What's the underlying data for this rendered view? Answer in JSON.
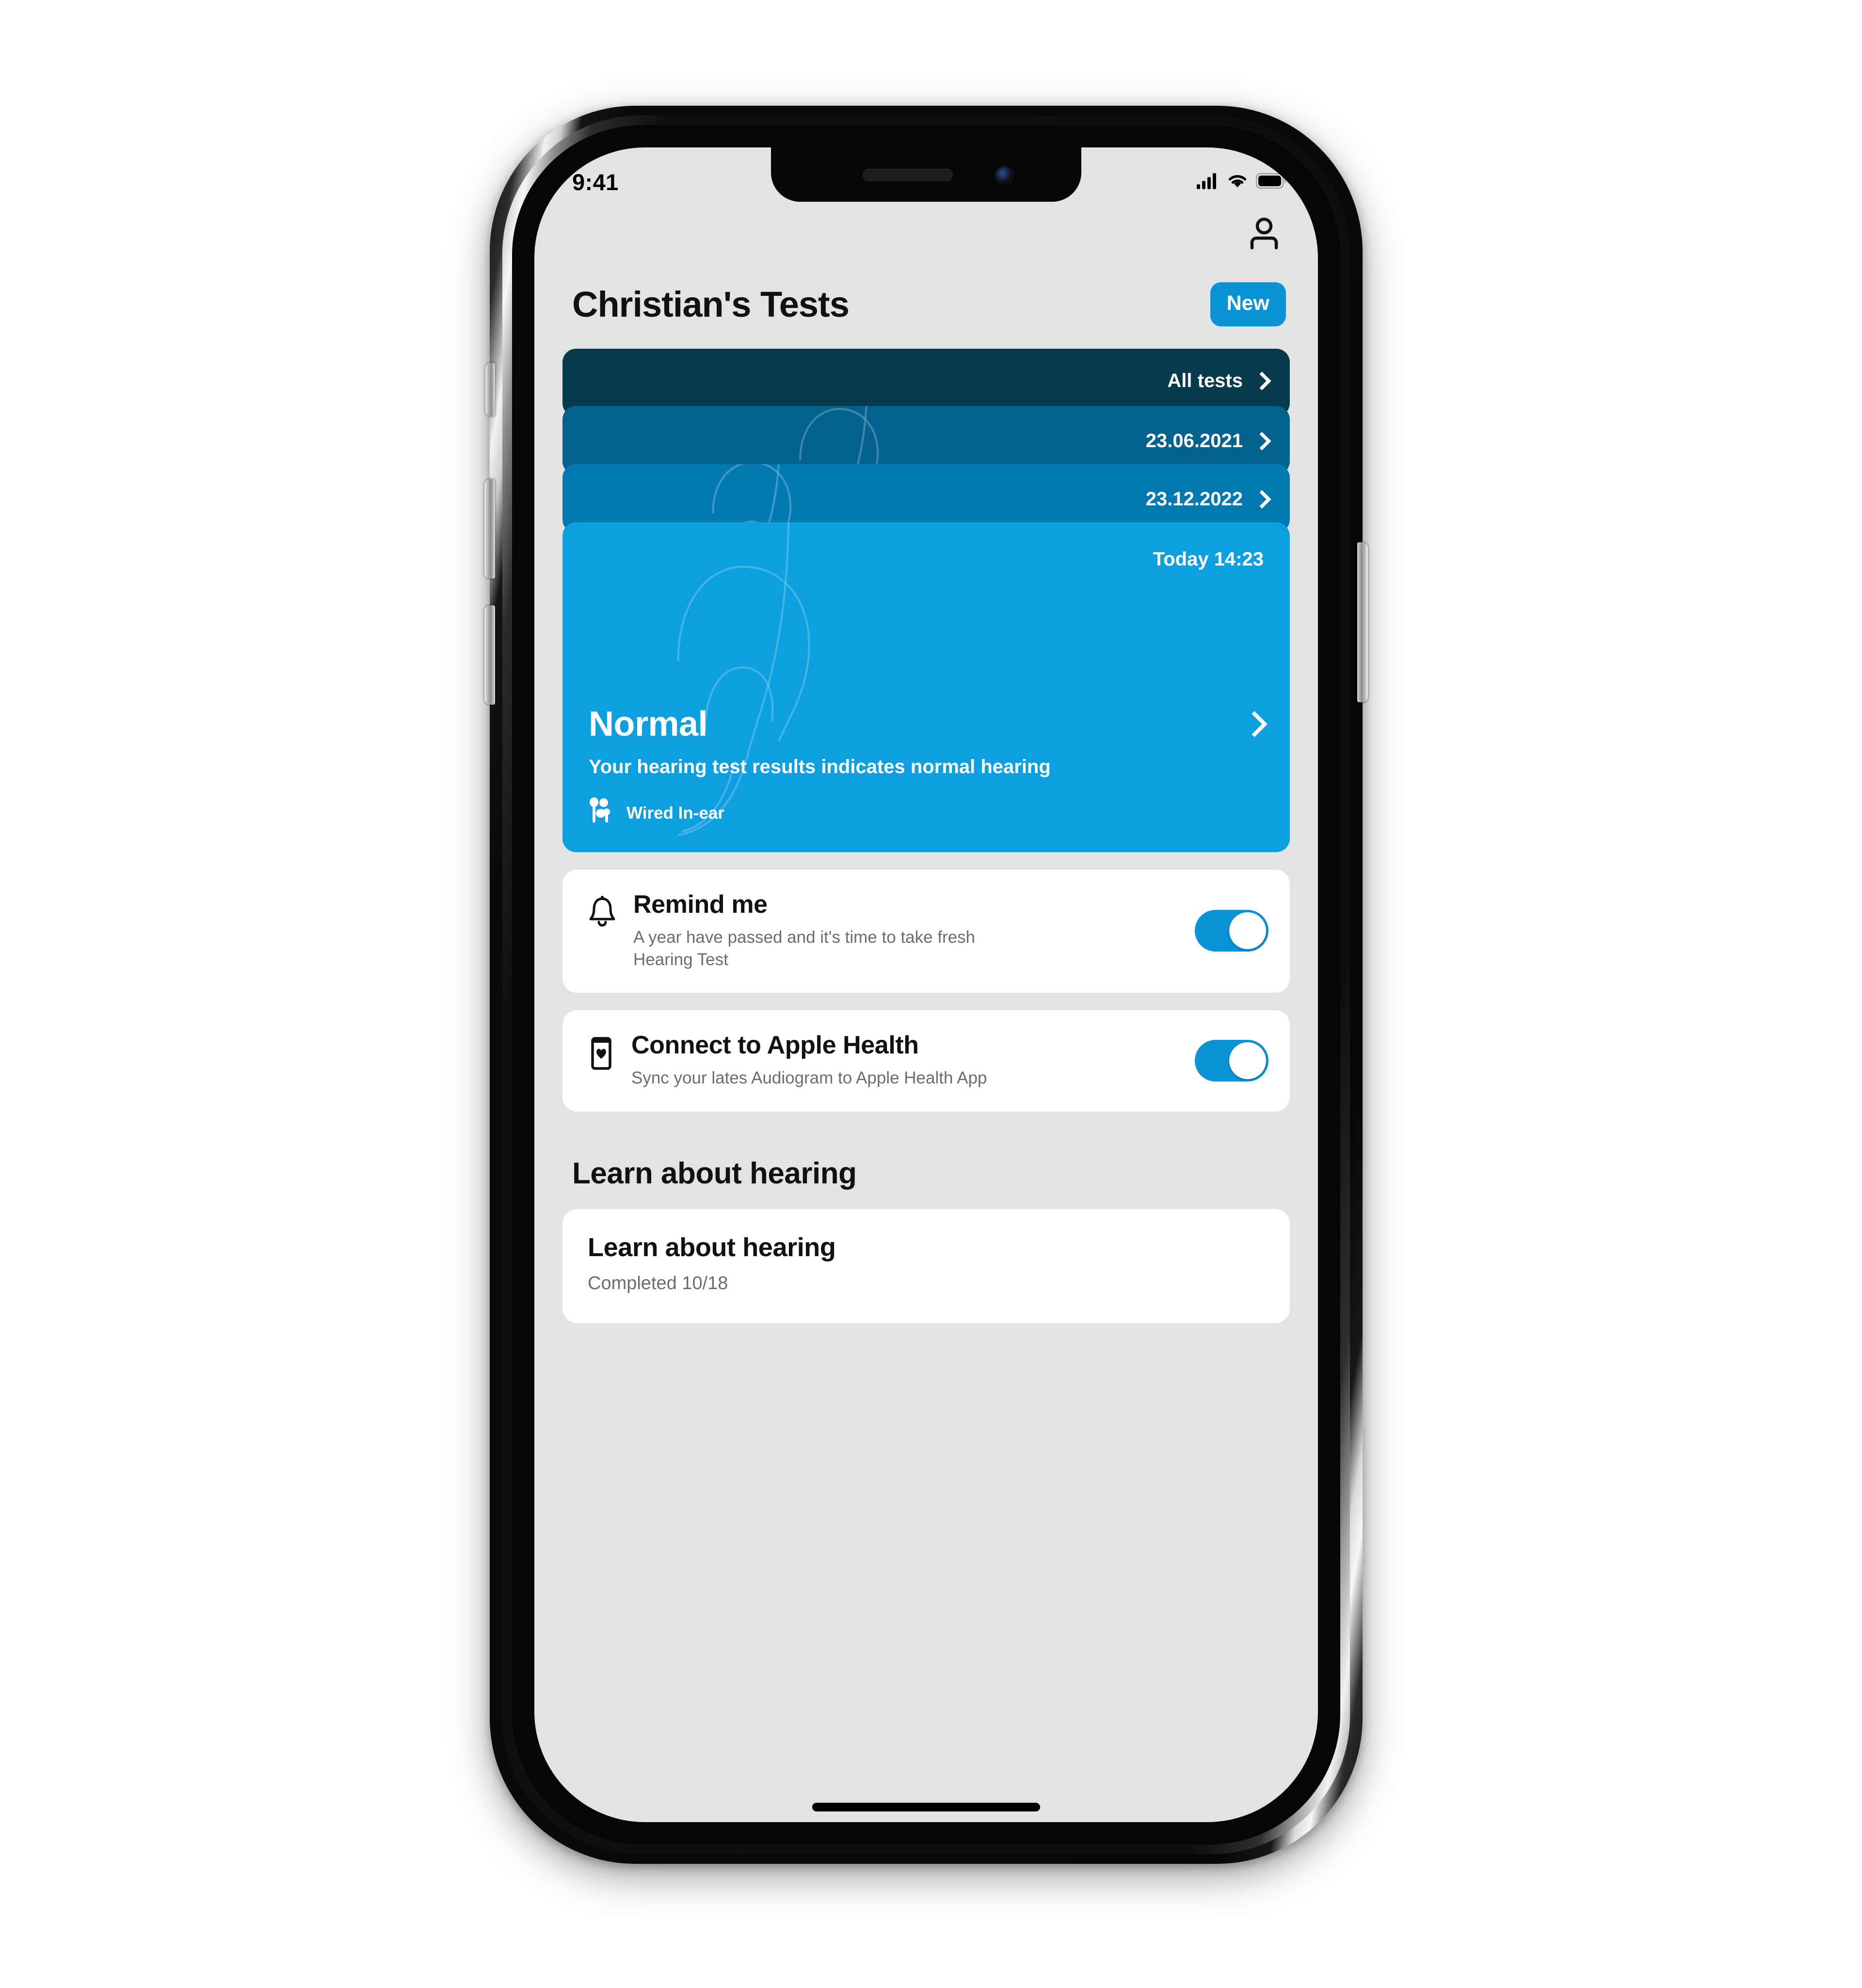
{
  "status_bar": {
    "time": "9:41",
    "signal_icon": "cellular-signal-icon",
    "wifi_icon": "wifi-icon",
    "battery_icon": "battery-full-icon"
  },
  "topbar": {
    "account_icon": "person-icon"
  },
  "header": {
    "title": "Christian's Tests",
    "new_button_label": "New"
  },
  "test_stack": {
    "all_tests_label": "All tests",
    "items": [
      {
        "label": "23.06.2021",
        "color": "#04628e"
      },
      {
        "label": "23.12.2022",
        "color": "#0379b1"
      }
    ],
    "latest": {
      "timestamp": "Today 14:23",
      "result_title": "Normal",
      "result_description": "Your hearing test results indicates normal hearing",
      "device_label": "Wired In-ear",
      "device_icon": "earbuds-icon",
      "color": "#0d9fdf"
    },
    "colors": {
      "all_tests_card": "#073a4a",
      "card_2021": "#04628e",
      "card_2022": "#0379b1",
      "latest_card": "#0d9fdf"
    }
  },
  "settings": [
    {
      "icon": "bell-icon",
      "title": "Remind me",
      "subtitle": "A year have passed and it's time to take fresh Hearing Test",
      "toggle_on": true
    },
    {
      "icon": "phone-heart-icon",
      "title": "Connect to Apple Health",
      "subtitle": "Sync your lates Audiogram to Apple Health App",
      "toggle_on": true
    }
  ],
  "learn_section": {
    "heading": "Learn about hearing",
    "card": {
      "title": "Learn about hearing",
      "progress_label": "Completed 10/18"
    }
  },
  "theme": {
    "accent": "#0a93d6",
    "screen_background": "#e3e3e3",
    "card_background": "#ffffff",
    "text_primary": "#111111",
    "text_secondary": "#6d6d6d"
  }
}
